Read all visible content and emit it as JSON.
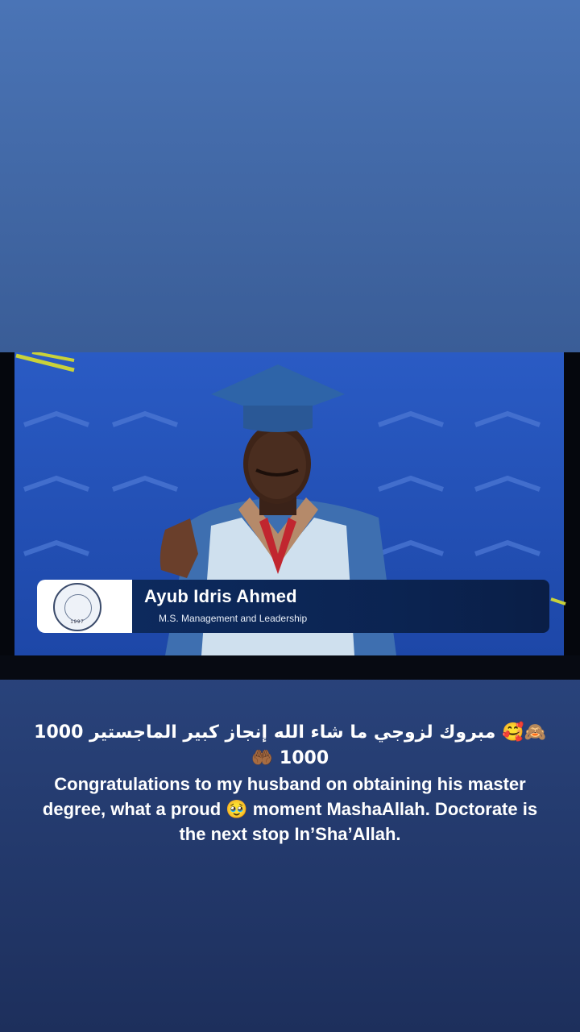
{
  "story": {
    "caption_arabic": "🙈🥰 مبروك لزوجي ما شاء الله إنجاز كبير الماجستير 1000 1000 🤲🏾",
    "caption_english": "Congratulations to my husband on obtaining his master degree, what a proud 🥹 moment MashaAllah. Doctorate is the next stop In’Sha’Allah."
  },
  "broadcast": {
    "graduate_name": "Ayub Idris Ahmed",
    "degree": "M.S. Management and Leadership",
    "seal_year": "1997"
  }
}
